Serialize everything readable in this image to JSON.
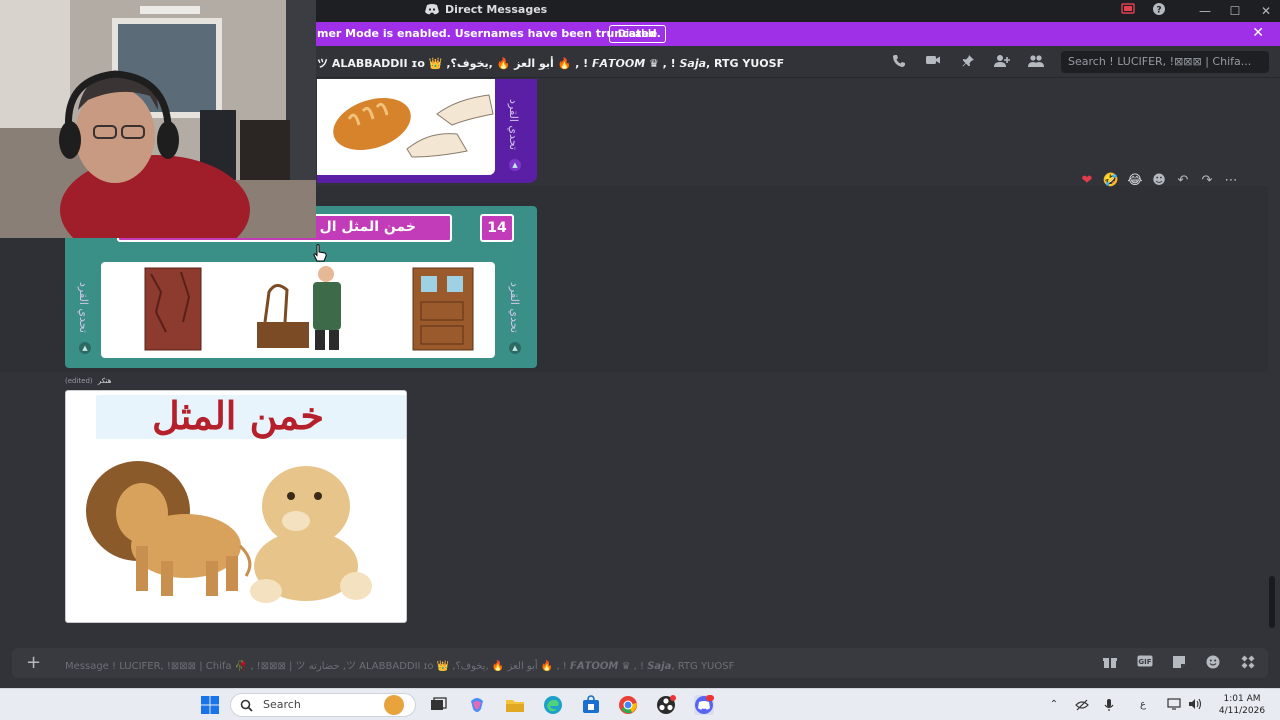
{
  "window": {
    "title": "Direct Messages"
  },
  "banner": {
    "text": "mer Mode is enabled. Usernames have been truncated.",
    "disable_label": "Disable"
  },
  "header": {
    "recipients": "ツ ALABBADDII ɪᴏ 👑 ,أبو العز 🔥 ,يخوف؟ 🔥 , ! 𝙁𝘼𝙏𝙊𝙊𝙈 ♛ , ! 𝙎𝙖𝙟𝙖, RTG YUOSF",
    "search_placeholder": "Search ! LUCIFER, !⊠⊠⊠ | Chifa..."
  },
  "messages": {
    "card1": {
      "side_label": "تحدي القرد"
    },
    "card2": {
      "title": "خمن المثل ال",
      "number": "14",
      "side_label_left": "تحدي القرد",
      "side_label_right": "تحدي القرد"
    },
    "card3": {
      "author": "هتكر",
      "edited": "(edited)",
      "heading": "خمن المثل"
    }
  },
  "reactions": [
    "❤",
    "🤣",
    "😂",
    "☻",
    "↶",
    "↷",
    "⋯"
  ],
  "composer": {
    "placeholder": "Message ! LUCIFER, !⊠⊠⊠ | Chifa 🥀 , !⊠⊠⊠ | ツ حضارته ,ツ ALABBADDII ɪᴏ 👑 ,أبو العز 🔥 ,يخوف؟ 🔥 , ! 𝙁𝘼𝙏𝙊𝙊𝙈 ♛ , ! 𝙎𝙖𝙟𝙖, RTG YUOSF"
  },
  "taskbar": {
    "search_label": "Search",
    "time": "1:01 AM",
    "date": "4/11/2026",
    "lang": "ع"
  },
  "colors": {
    "banner": "#a030e8",
    "card_purple": "#5b1fa6",
    "card_teal": "#3a8f86",
    "title_magenta": "#c23bb8",
    "heading_red": "#b5202a"
  }
}
